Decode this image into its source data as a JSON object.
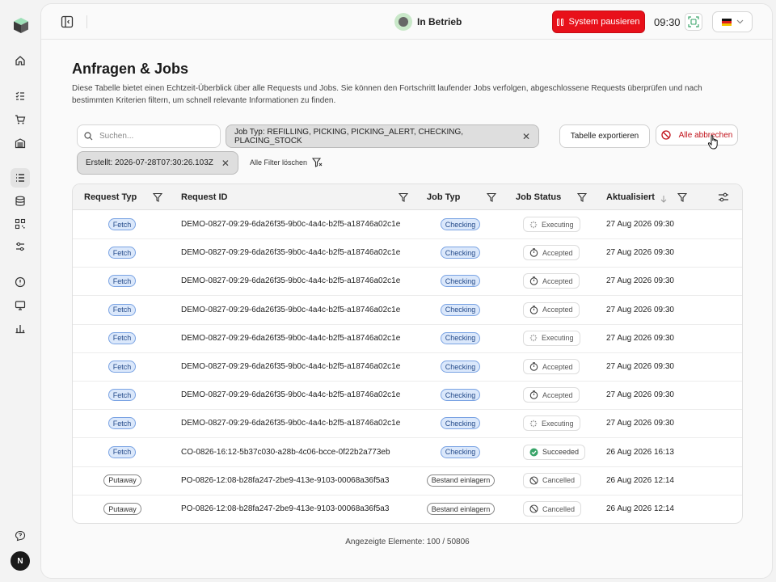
{
  "sidebar": {
    "logo": "cube-logo",
    "avatar_initial": "N"
  },
  "header": {
    "status_text": "In Betrieb",
    "pause_button": "System pausieren",
    "clock": "09:30",
    "language": "DE",
    "colors": {
      "accent_red": "#e8101a",
      "status_green": "#c9e8c9"
    }
  },
  "page": {
    "title": "Anfragen & Jobs",
    "description": "Diese Tabelle bietet einen Echtzeit-Überblick über alle Requests und Jobs. Sie können den Fortschritt laufender Jobs verfolgen, abgeschlossene Requests überprüfen und nach bestimmten Kriterien filtern, um schnell relevante Informationen zu finden."
  },
  "filters": {
    "search_placeholder": "Suchen...",
    "chip_job_type": "Job Typ: REFILLING, PICKING, PICKING_ALERT, CHECKING, PLACING_STOCK",
    "chip_created": "Erstellt: 2026-07-28T07:30:26.103Z",
    "clear_label": "Alle Filter löschen",
    "export_label": "Tabelle exportieren",
    "cancel_all_label": "Alle abbrechen"
  },
  "table": {
    "headers": {
      "request_type": "Request Typ",
      "request_id": "Request ID",
      "job_type": "Job Typ",
      "job_status": "Job Status",
      "updated": "Aktualisiert"
    },
    "rows": [
      {
        "type": "Fetch",
        "id": "DEMO-0827-09:29-6da26f35-9b0c-4a4c-b2f5-a18746a02c1e",
        "job": "Checking",
        "status": "Executing",
        "updated": "27 Aug 2026 09:30"
      },
      {
        "type": "Fetch",
        "id": "DEMO-0827-09:29-6da26f35-9b0c-4a4c-b2f5-a18746a02c1e",
        "job": "Checking",
        "status": "Accepted",
        "updated": "27 Aug 2026 09:30"
      },
      {
        "type": "Fetch",
        "id": "DEMO-0827-09:29-6da26f35-9b0c-4a4c-b2f5-a18746a02c1e",
        "job": "Checking",
        "status": "Accepted",
        "updated": "27 Aug 2026 09:30"
      },
      {
        "type": "Fetch",
        "id": "DEMO-0827-09:29-6da26f35-9b0c-4a4c-b2f5-a18746a02c1e",
        "job": "Checking",
        "status": "Accepted",
        "updated": "27 Aug 2026 09:30"
      },
      {
        "type": "Fetch",
        "id": "DEMO-0827-09:29-6da26f35-9b0c-4a4c-b2f5-a18746a02c1e",
        "job": "Checking",
        "status": "Executing",
        "updated": "27 Aug 2026 09:30"
      },
      {
        "type": "Fetch",
        "id": "DEMO-0827-09:29-6da26f35-9b0c-4a4c-b2f5-a18746a02c1e",
        "job": "Checking",
        "status": "Accepted",
        "updated": "27 Aug 2026 09:30"
      },
      {
        "type": "Fetch",
        "id": "DEMO-0827-09:29-6da26f35-9b0c-4a4c-b2f5-a18746a02c1e",
        "job": "Checking",
        "status": "Accepted",
        "updated": "27 Aug 2026 09:30"
      },
      {
        "type": "Fetch",
        "id": "DEMO-0827-09:29-6da26f35-9b0c-4a4c-b2f5-a18746a02c1e",
        "job": "Checking",
        "status": "Executing",
        "updated": "27 Aug 2026 09:30"
      },
      {
        "type": "Fetch",
        "id": "CO-0826-16:12-5b37c030-a28b-4c06-bcce-0f22b2a773eb",
        "job": "Checking",
        "status": "Succeeded",
        "updated": "26 Aug 2026 16:13"
      },
      {
        "type": "Putaway",
        "id": "PO-0826-12:08-b28fa247-2be9-413e-9103-00068a36f5a3",
        "job": "Bestand einlagern",
        "status": "Cancelled",
        "updated": "26 Aug 2026 12:14"
      },
      {
        "type": "Putaway",
        "id": "PO-0826-12:08-b28fa247-2be9-413e-9103-00068a36f5a3",
        "job": "Bestand einlagern",
        "status": "Cancelled",
        "updated": "26 Aug 2026 12:14"
      }
    ]
  },
  "footer": {
    "count_text": "Angezeigte Elemente: 100 / 50806"
  }
}
